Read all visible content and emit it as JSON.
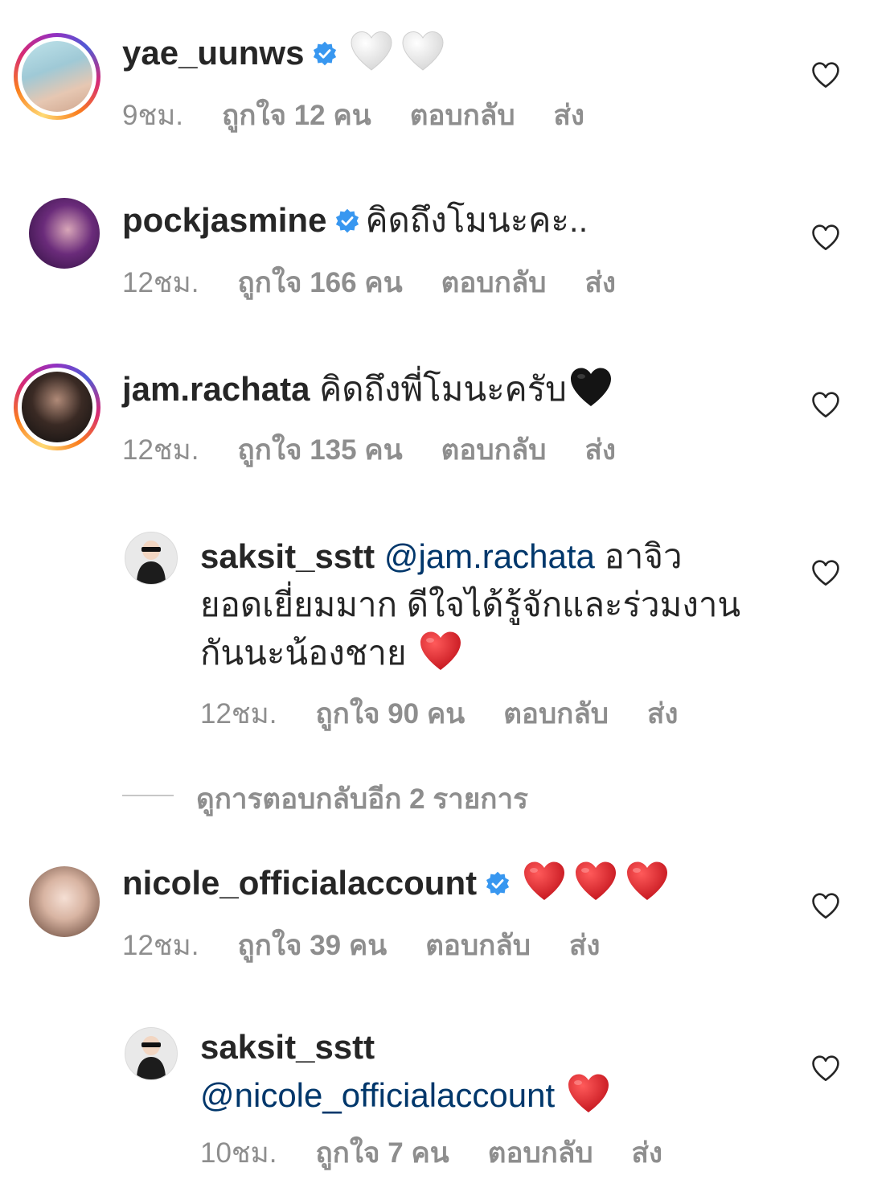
{
  "comments": [
    {
      "username": "yae_uunws",
      "verified": true,
      "text": "",
      "emojis": [
        "white-heart",
        "white-heart"
      ],
      "time": "9ชม.",
      "likes": "ถูกใจ 12 คน",
      "reply": "ตอบกลับ",
      "send": "ส่ง"
    },
    {
      "username": "pockjasmine",
      "verified": true,
      "text": "คิดถึงโมนะคะ..",
      "time": "12ชม.",
      "likes": "ถูกใจ 166 คน",
      "reply": "ตอบกลับ",
      "send": "ส่ง"
    },
    {
      "username": "jam.rachata",
      "verified": false,
      "text": "คิดถึงพี่โมนะครับ",
      "emojis": [
        "black-heart"
      ],
      "time": "12ชม.",
      "likes": "ถูกใจ 135 คน",
      "reply": "ตอบกลับ",
      "send": "ส่ง"
    },
    {
      "username": "saksit_sstt",
      "mention": "@jam.rachata",
      "text_line1": "อาจิว",
      "text_line2": "ยอดเยี่ยมมาก ดีใจได้รู้จักและร่วมงาน",
      "text_line3": "กันนะน้องชาย",
      "emojis": [
        "red-heart"
      ],
      "time": "12ชม.",
      "likes": "ถูกใจ 90 คน",
      "reply": "ตอบกลับ",
      "send": "ส่ง"
    },
    {
      "username": "nicole_officialaccount",
      "verified": true,
      "emojis": [
        "red-heart",
        "red-heart",
        "red-heart"
      ],
      "time": "12ชม.",
      "likes": "ถูกใจ 39 คน",
      "reply": "ตอบกลับ",
      "send": "ส่ง"
    },
    {
      "username": "saksit_sstt",
      "mention": "@nicole_officialaccount",
      "emojis": [
        "red-heart"
      ],
      "time": "10ชม.",
      "likes": "ถูกใจ 7 คน",
      "reply": "ตอบกลับ",
      "send": "ส่ง"
    }
  ],
  "more_replies": "ดูการตอบกลับอีก 2 รายการ",
  "colors": {
    "text": "#262626",
    "meta": "#8e8e8e",
    "mention": "#00376b",
    "verified": "#3897f0",
    "red_heart": "#e0202c",
    "story_ring": "#d62976"
  }
}
